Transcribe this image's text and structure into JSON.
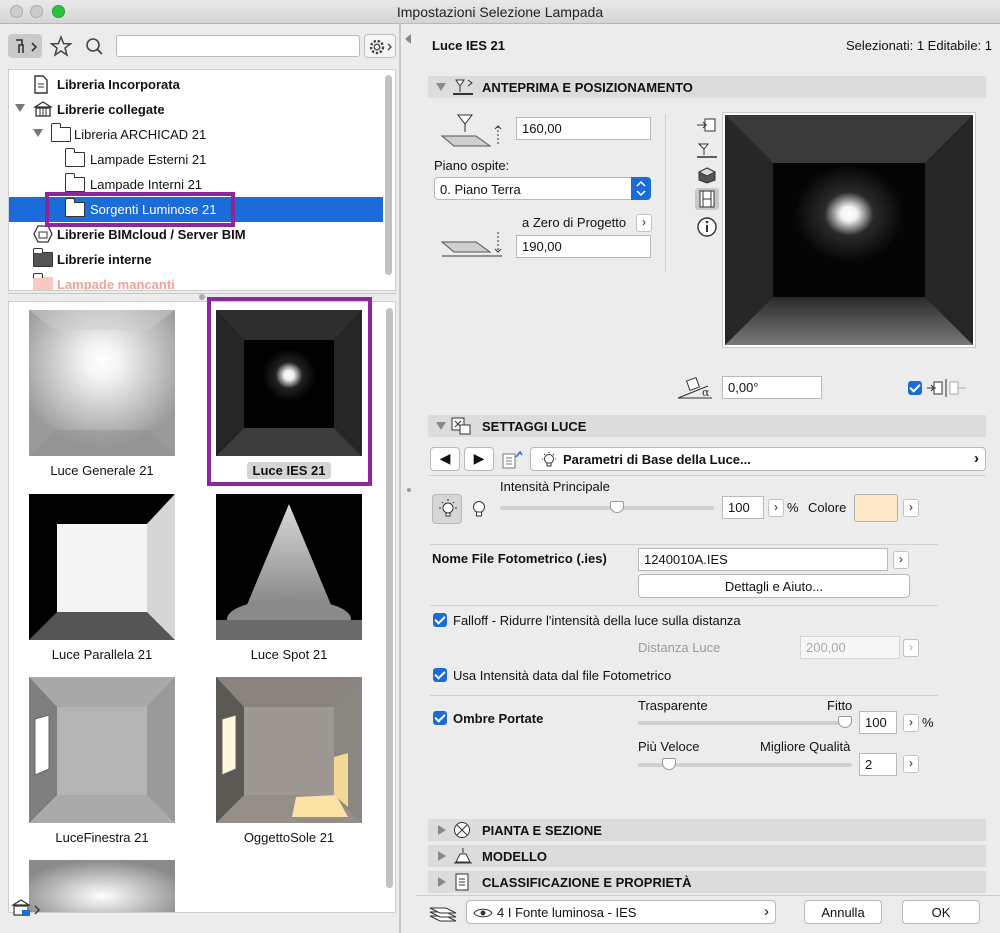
{
  "window": {
    "title": "Impostazioni Selezione Lampada"
  },
  "search": {
    "value": ""
  },
  "tree": {
    "items": [
      {
        "label": "Libreria Incorporata"
      },
      {
        "label": "Librerie collegate"
      },
      {
        "label": "Libreria ARCHICAD 21"
      },
      {
        "label": "Lampade Esterni 21"
      },
      {
        "label": "Lampade Interni 21"
      },
      {
        "label": "Sorgenti Luminose 21"
      },
      {
        "label": "Librerie BIMcloud / Server BIM"
      },
      {
        "label": "Librerie interne"
      },
      {
        "label": "Lampade mancanti"
      }
    ]
  },
  "thumbnails": [
    {
      "label": "Luce Generale 21"
    },
    {
      "label": "Luce IES 21"
    },
    {
      "label": "Luce Parallela 21"
    },
    {
      "label": "Luce Spot 21"
    },
    {
      "label": "LuceFinestra 21"
    },
    {
      "label": "OggettoSole 21"
    }
  ],
  "header": {
    "object_name": "Luce IES 21",
    "selection_info": "Selezionati: 1 Editabile: 1"
  },
  "preview_section": {
    "title": "ANTEPRIMA E POSIZIONAMENTO",
    "height_value": "160,00",
    "host_story_label": "Piano ospite:",
    "host_story_value": "0. Piano Terra",
    "reference_label": "a Zero di Progetto",
    "elevation_value": "190,00",
    "rotation_value": "0,00°"
  },
  "light_section": {
    "title": "SETTAGGI LUCE",
    "panel_selector": "Parametri di Base della Luce...",
    "intensity_label": "Intensità Principale",
    "intensity_value": "100",
    "intensity_unit": "%",
    "color_label": "Colore",
    "color_swatch": "#fde9c8",
    "ies_label": "Nome File Fotometrico (.ies)",
    "ies_value": "1240010A.IES",
    "details_button": "Dettagli e Aiuto...",
    "falloff_label": "Falloff - Ridurre l'intensità della luce sulla distanza",
    "distance_label": "Distanza Luce",
    "distance_value": "200,00",
    "use_intensity_label": "Usa Intensità data dal file Fotometrico",
    "shadows_label": "Ombre Portate",
    "transparent_label": "Trasparente",
    "dense_label": "Fitto",
    "shadow_density_value": "100",
    "shadow_unit": "%",
    "faster_label": "Più Veloce",
    "quality_label": "Migliore Qualità",
    "quality_value": "2",
    "intensity_level": 0.55,
    "shadow_level": 1.0,
    "quality_level": 0.12
  },
  "sections": [
    {
      "title": "PIANTA E SEZIONE"
    },
    {
      "title": "MODELLO"
    },
    {
      "title": "CLASSIFICAZIONE E PROPRIETÀ"
    }
  ],
  "footer": {
    "layer_value": "4 I Fonte luminosa - IES",
    "cancel": "Annulla",
    "ok": "OK"
  },
  "colors": {
    "accent": "#1b6cd9",
    "highlight": "#8a2a9a"
  }
}
